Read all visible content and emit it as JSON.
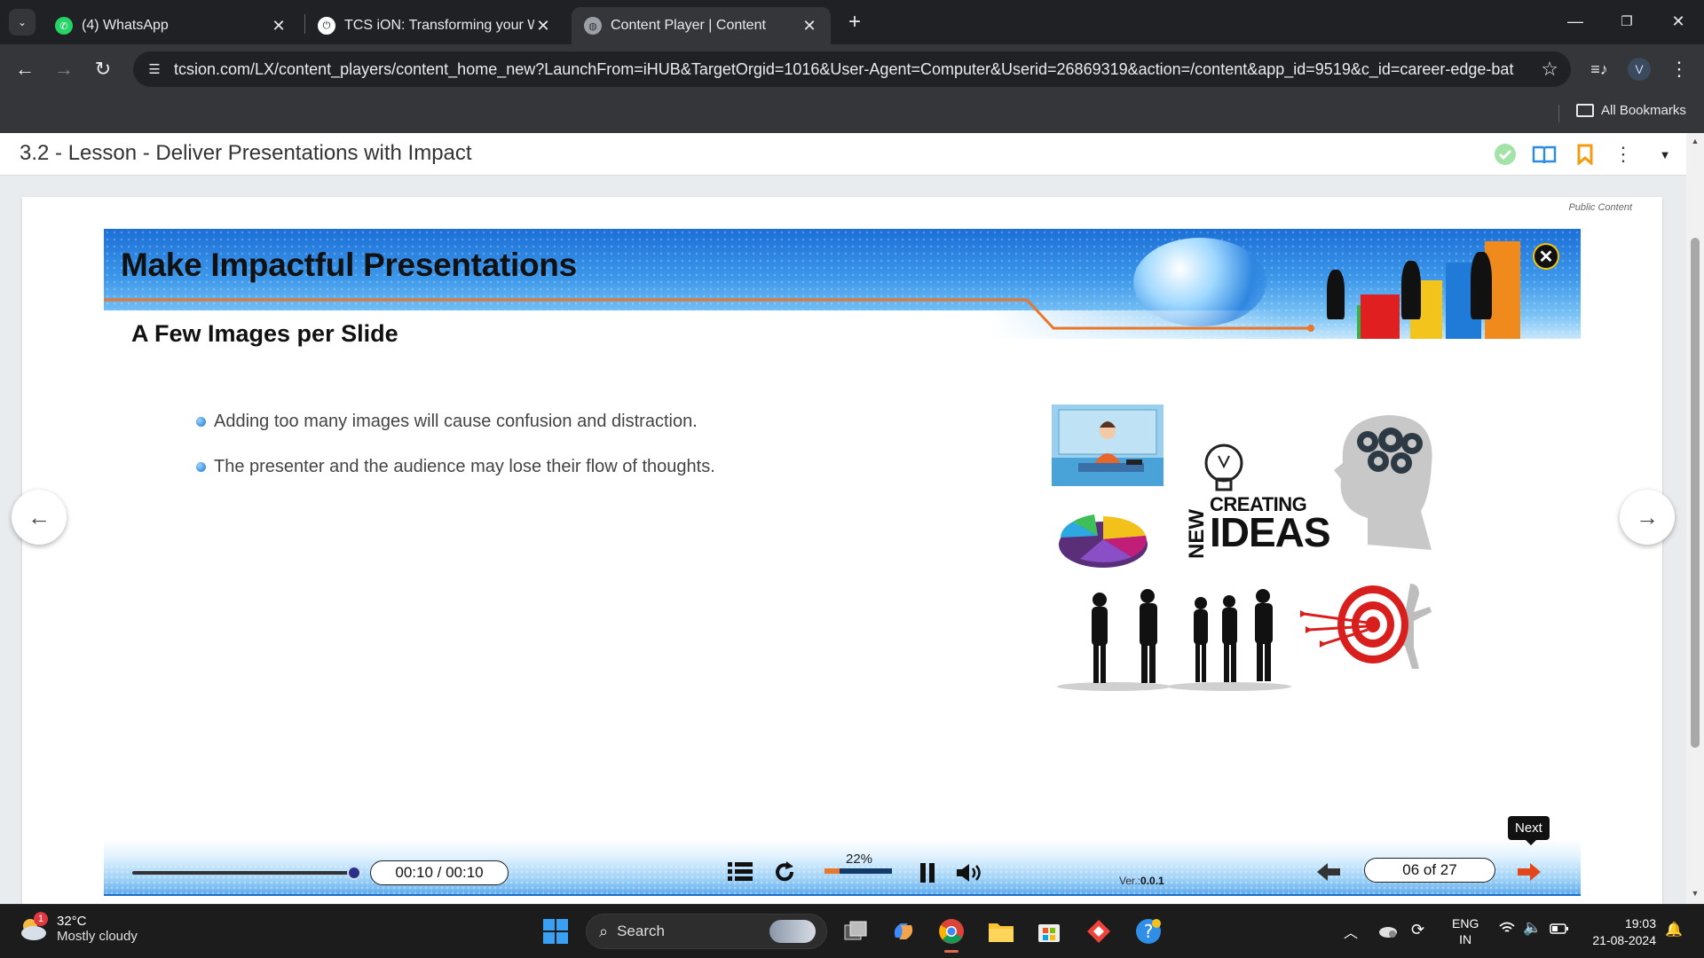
{
  "browser": {
    "tabs": [
      {
        "title": "(4) WhatsApp",
        "icon": "whatsapp-icon"
      },
      {
        "title": "TCS iON: Transforming your Wo",
        "icon": "tcs-ion-icon"
      },
      {
        "title": "Content Player | Content",
        "icon": "globe-icon",
        "active": true
      }
    ],
    "url": "tcsion.com/LX/content_players/content_home_new?LaunchFrom=iHUB&TargetOrgid=1016&User-Agent=Computer&Userid=26869319&action=/content&app_id=9519&c_id=career-edge-batch...",
    "profile_initial": "V",
    "bookmarks_label": "All Bookmarks"
  },
  "lesson": {
    "title": "3.2 - Lesson - Deliver Presentations with Impact"
  },
  "card": {
    "public_label": "Public Content"
  },
  "slide": {
    "title": "Make Impactful Presentations",
    "subtitle": "A Few Images per Slide",
    "bullets": [
      "Adding too many images will cause confusion and distraction.",
      "The presenter and the audience may lose their flow of thoughts."
    ],
    "ideas_new": "NEW",
    "ideas_creating": "CREATING",
    "ideas_ideas": "IDEAS"
  },
  "player": {
    "time": "00:10 / 00:10",
    "seek_fraction": 1.0,
    "progress_label": "22%",
    "progress_fraction": 0.22,
    "version_label": "Ver.:",
    "version_value": "0.0.1",
    "page_counter": "06 of 27",
    "next_tooltip": "Next"
  },
  "taskbar": {
    "weather_temp": "32°C",
    "weather_desc": "Mostly cloudy",
    "weather_badge": "1",
    "search_label": "Search",
    "lang_top": "ENG",
    "lang_bottom": "IN",
    "time": "19:03",
    "date": "21-08-2024"
  },
  "colors": {
    "accent_orange": "#e8762b",
    "banner_blue": "#1b6fd6",
    "chrome_dark": "#202124"
  }
}
